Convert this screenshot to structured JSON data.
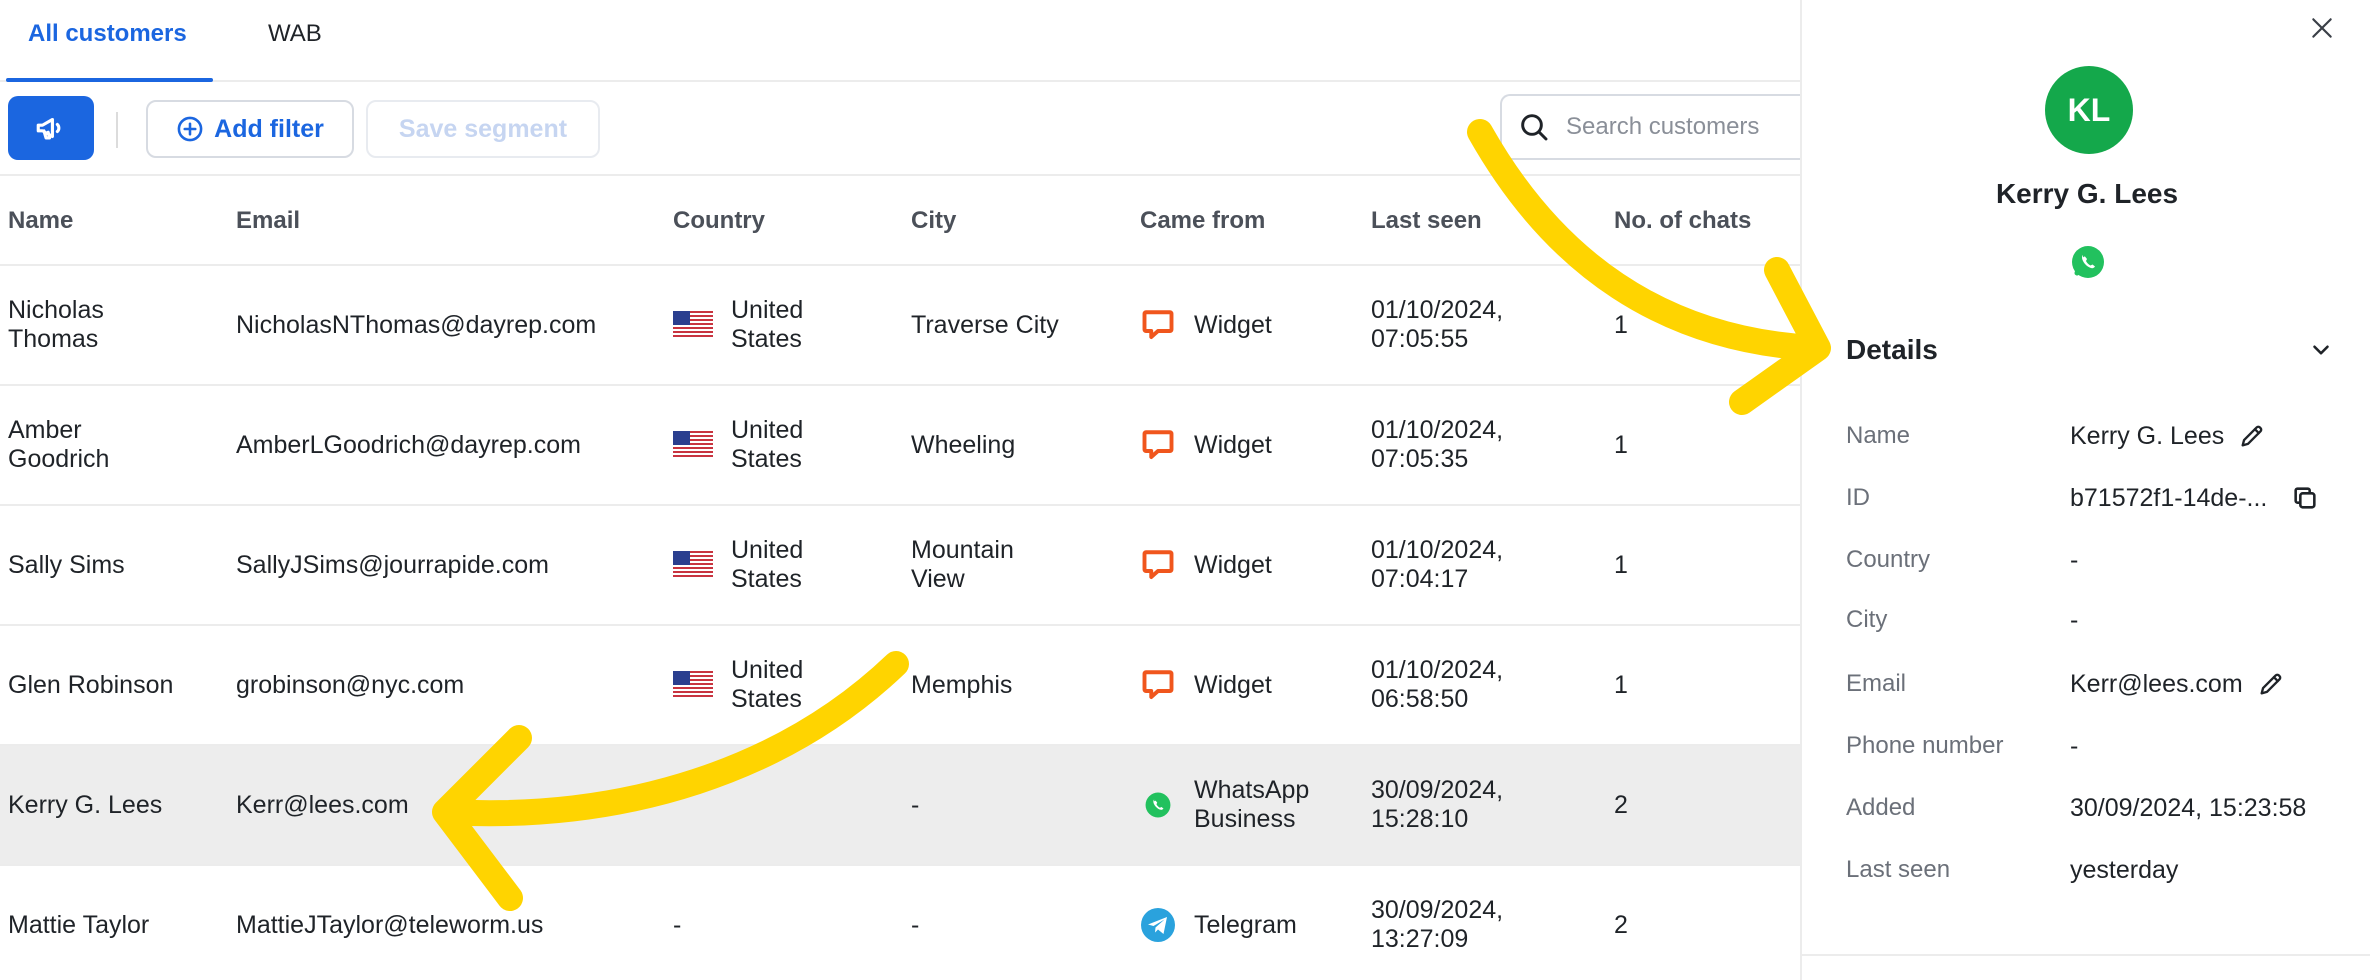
{
  "tabs": [
    {
      "label": "All customers",
      "active": true
    },
    {
      "label": "WAB",
      "active": false
    }
  ],
  "toolbar": {
    "announce_icon": "megaphone-icon",
    "add_filter_label": "Add filter",
    "save_segment_label": "Save segment",
    "search_placeholder": "Search customers"
  },
  "table": {
    "columns": [
      "Name",
      "Email",
      "Country",
      "City",
      "Came from",
      "Last seen",
      "No. of chats"
    ],
    "rows": [
      {
        "name": [
          "Nicholas",
          "Thomas"
        ],
        "email": "NicholasNThomas@dayrep.com",
        "country": [
          "United",
          "States"
        ],
        "flag": "us-flag-icon",
        "city": [
          "Traverse City"
        ],
        "source": [
          "Widget"
        ],
        "source_icon": "widget-chat-icon",
        "last_seen": [
          "01/10/2024,",
          "07:05:55"
        ],
        "chats": "1",
        "selected": false
      },
      {
        "name": [
          "Amber",
          "Goodrich"
        ],
        "email": "AmberLGoodrich@dayrep.com",
        "country": [
          "United",
          "States"
        ],
        "flag": "us-flag-icon",
        "city": [
          "Wheeling"
        ],
        "source": [
          "Widget"
        ],
        "source_icon": "widget-chat-icon",
        "last_seen": [
          "01/10/2024,",
          "07:05:35"
        ],
        "chats": "1",
        "selected": false
      },
      {
        "name": [
          "Sally Sims"
        ],
        "email": "SallyJSims@jourrapide.com",
        "country": [
          "United",
          "States"
        ],
        "flag": "us-flag-icon",
        "city": [
          "Mountain",
          "View"
        ],
        "source": [
          "Widget"
        ],
        "source_icon": "widget-chat-icon",
        "last_seen": [
          "01/10/2024,",
          "07:04:17"
        ],
        "chats": "1",
        "selected": false
      },
      {
        "name": [
          "Glen Robinson"
        ],
        "email": "grobinson@nyc.com",
        "country": [
          "United",
          "States"
        ],
        "flag": "us-flag-icon",
        "city": [
          "Memphis"
        ],
        "source": [
          "Widget"
        ],
        "source_icon": "widget-chat-icon",
        "last_seen": [
          "01/10/2024,",
          "06:58:50"
        ],
        "chats": "1",
        "selected": false
      },
      {
        "name": [
          "Kerry G. Lees"
        ],
        "email": "Kerr@lees.com",
        "country": [],
        "flag": "",
        "city": [
          "-"
        ],
        "source": [
          "WhatsApp",
          "Business"
        ],
        "source_icon": "whatsapp-icon",
        "last_seen": [
          "30/09/2024,",
          "15:28:10"
        ],
        "chats": "2",
        "selected": true
      },
      {
        "name": [
          "Mattie Taylor"
        ],
        "email": "MattieJTaylor@teleworm.us",
        "country": [
          "-"
        ],
        "flag": "",
        "city": [
          "-"
        ],
        "source": [
          "Telegram"
        ],
        "source_icon": "telegram-icon",
        "last_seen": [
          "30/09/2024,",
          "13:27:09"
        ],
        "chats": "2",
        "selected": false
      }
    ]
  },
  "panel": {
    "initials": "KL",
    "name": "Kerry G. Lees",
    "channel_icon": "whatsapp-icon",
    "avatar_color": "#14a84b",
    "details_title": "Details",
    "details": [
      {
        "label": "Name",
        "value": "Kerry G. Lees",
        "action": "edit"
      },
      {
        "label": "ID",
        "value": "b71572f1-14de-...",
        "action": "copy"
      },
      {
        "label": "Country",
        "value": "-",
        "action": ""
      },
      {
        "label": "City",
        "value": "-",
        "action": ""
      },
      {
        "label": "Email",
        "value": "Kerr@lees.com",
        "action": "edit"
      },
      {
        "label": "Phone number",
        "value": "-",
        "action": ""
      },
      {
        "label": "Added",
        "value": "30/09/2024, 15:23:58",
        "action": ""
      },
      {
        "label": "Last seen",
        "value": "yesterday",
        "action": ""
      }
    ]
  },
  "colors": {
    "accent": "#1b66e0",
    "widget": "#f0561d",
    "whatsapp": "#22c15e",
    "telegram": "#2aa2dd",
    "annotation_arrow": "#ffd400",
    "selected_row": "#ededed"
  }
}
